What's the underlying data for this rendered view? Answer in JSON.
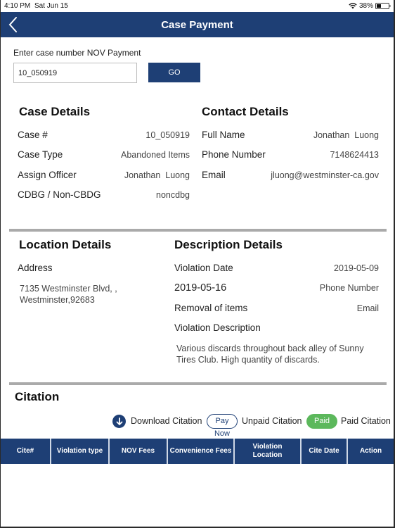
{
  "status_bar": {
    "time": "4:10 PM",
    "date": "Sat Jun 15",
    "battery": "38%",
    "battery_level": 0.38
  },
  "nav": {
    "title": "Case Payment",
    "back_icon": "chevron-left-icon"
  },
  "search": {
    "label": "Enter case number NOV Payment",
    "value": "10_050919",
    "go_label": "GO"
  },
  "case_details": {
    "title": "Case Details",
    "rows": [
      {
        "label": "Case #",
        "value": "10_050919"
      },
      {
        "label": "Case Type",
        "value": "Abandoned Items"
      },
      {
        "label": "Assign Officer",
        "value": "Jonathan  Luong"
      },
      {
        "label": "CDBG / Non-CBDG",
        "value": "noncdbg"
      }
    ]
  },
  "contact_details": {
    "title": "Contact Details",
    "rows": [
      {
        "label": "Full Name",
        "value": "Jonathan  Luong"
      },
      {
        "label": "Phone Number",
        "value": "7148624413"
      },
      {
        "label": "Email",
        "value": "jluong@westminster-ca.gov"
      }
    ]
  },
  "location_details": {
    "title": "Location Details",
    "address_label": "Address",
    "address_line1": "7135 Westminster Blvd, ,",
    "address_line2": "Westminster,92683"
  },
  "description_details": {
    "title": "Description Details",
    "rows": [
      {
        "label": "Violation Date",
        "value": "2019-05-09"
      },
      {
        "label": "2019-05-16",
        "value": "Phone Number"
      },
      {
        "label": "Removal of items",
        "value": "Email"
      }
    ],
    "violation_description_label": "Violation Description",
    "violation_description": "Various discards throughout back alley of Sunny Tires Club. High quantity of discards."
  },
  "citation": {
    "title": "Citation",
    "legend": {
      "download_label": "Download Citation",
      "pay_now_pill": "Pay Now",
      "unpaid_label": "Unpaid Citation",
      "paid_pill": "Paid",
      "paid_label": "Paid Citation"
    },
    "columns": [
      "Cite#",
      "Violation type",
      "NOV Fees",
      "Convenience Fees",
      "Violation Location",
      "Cite Date",
      "Action"
    ],
    "rows": []
  },
  "colors": {
    "primary": "#1e3f75",
    "paid": "#5cb85c",
    "divider": "#aaaaaa"
  }
}
